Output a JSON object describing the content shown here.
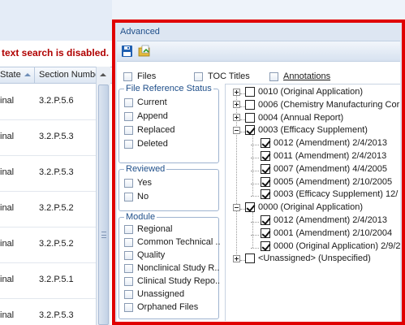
{
  "left": {
    "warning": "text search is disabled.",
    "columns": {
      "state": "State",
      "section": "Section Numbe"
    },
    "rows": [
      {
        "state": "inal",
        "section": "3.2.P.5.6"
      },
      {
        "state": "inal",
        "section": "3.2.P.5.3"
      },
      {
        "state": "inal",
        "section": "3.2.P.5.3"
      },
      {
        "state": "inal",
        "section": "3.2.P.5.2"
      },
      {
        "state": "inal",
        "section": "3.2.P.5.2"
      },
      {
        "state": "inal",
        "section": "3.2.P.5.1"
      },
      {
        "state": "inal",
        "section": "3.2.P.5.3"
      }
    ]
  },
  "advanced": {
    "title": "Advanced",
    "toolbar": {
      "save_icon": "save-icon",
      "open_icon": "open-folder-icon"
    },
    "top_options": {
      "files": "Files",
      "toc_titles": "TOC Titles",
      "annotations": "Annotations"
    },
    "file_reference_status": {
      "title": "File Reference Status",
      "items": [
        "Current",
        "Append",
        "Replaced",
        "Deleted"
      ]
    },
    "reviewed": {
      "title": "Reviewed",
      "items": [
        "Yes",
        "No"
      ]
    },
    "module": {
      "title": "Module",
      "items": [
        "Regional",
        "Common Technical ..",
        "Quality",
        "Nonclinical Study R..",
        "Clinical Study Repo..",
        "Unassigned",
        "Orphaned Files"
      ]
    },
    "tree": [
      {
        "label": "0010 (Original Application)",
        "checked": false,
        "expander": "plus",
        "level": 0
      },
      {
        "label": "0006 (Chemistry Manufacturing Cor",
        "checked": false,
        "expander": "plus",
        "level": 0
      },
      {
        "label": "0004 (Annual Report)",
        "checked": false,
        "expander": "plus",
        "level": 0
      },
      {
        "label": "0003 (Efficacy Supplement)",
        "checked": true,
        "expander": "minus",
        "level": 0
      },
      {
        "label": "0012 (Amendment) 2/4/2013",
        "checked": true,
        "expander": "none",
        "level": 1
      },
      {
        "label": "0011 (Amendment) 2/4/2013",
        "checked": true,
        "expander": "none",
        "level": 1
      },
      {
        "label": "0007 (Amendment) 4/4/2005",
        "checked": true,
        "expander": "none",
        "level": 1
      },
      {
        "label": "0005 (Amendment) 2/10/2005",
        "checked": true,
        "expander": "none",
        "level": 1
      },
      {
        "label": "0003 (Efficacy Supplement) 12/",
        "checked": true,
        "expander": "none",
        "level": 1
      },
      {
        "label": "0000 (Original Application)",
        "checked": true,
        "expander": "minus",
        "level": 0
      },
      {
        "label": "0012 (Amendment) 2/4/2013",
        "checked": true,
        "expander": "none",
        "level": 1
      },
      {
        "label": "0001 (Amendment) 2/10/2004",
        "checked": true,
        "expander": "none",
        "level": 1
      },
      {
        "label": "0000 (Original Application) 2/9/2",
        "checked": true,
        "expander": "none",
        "level": 1
      },
      {
        "label": "<Unassigned> (Unspecified)",
        "checked": false,
        "expander": "plus",
        "level": 0
      }
    ]
  }
}
